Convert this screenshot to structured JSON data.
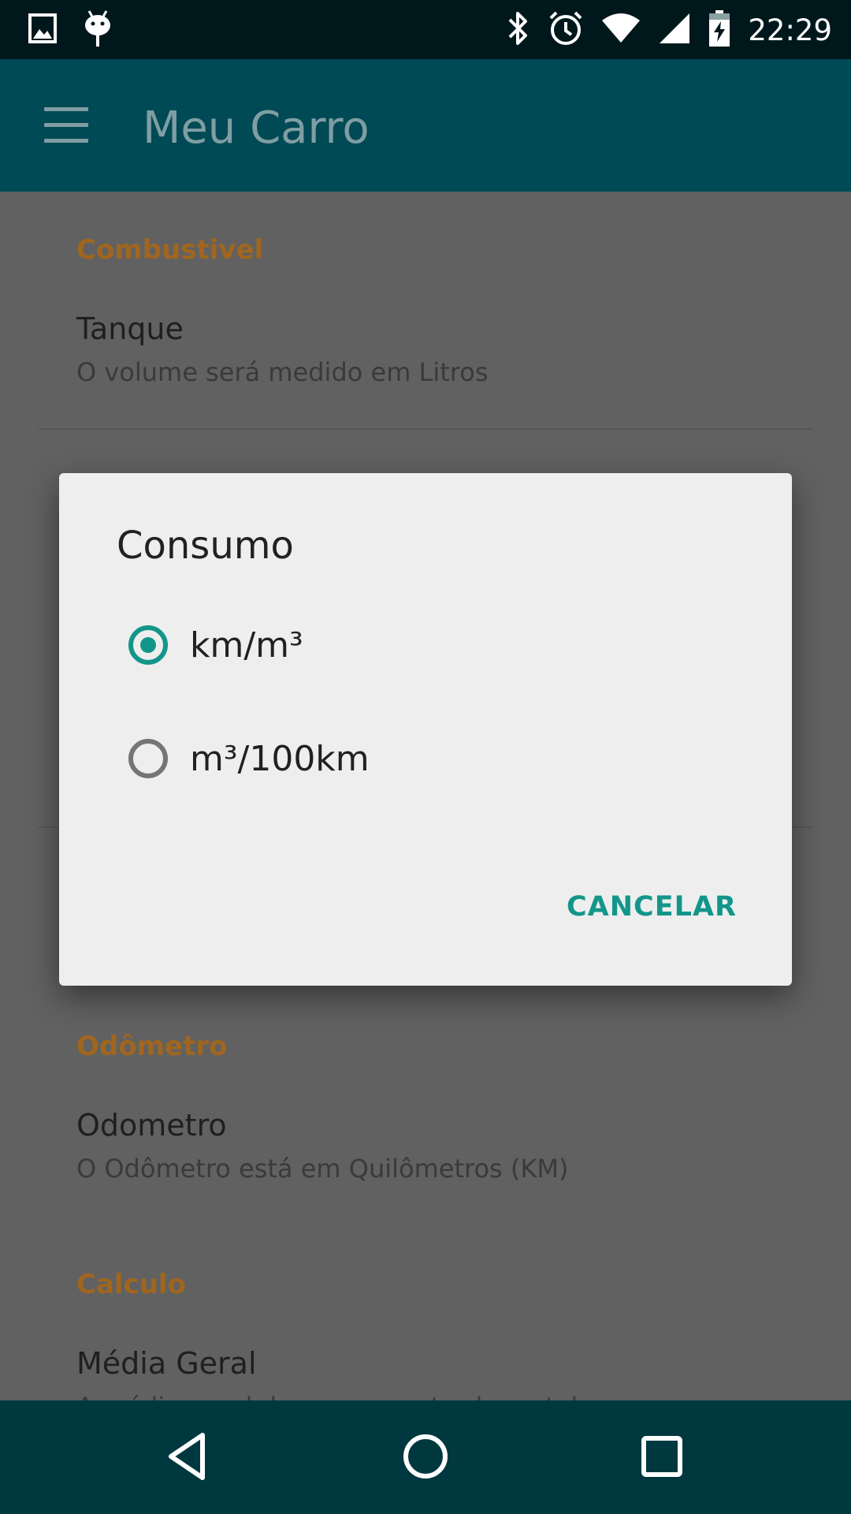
{
  "status_bar": {
    "time": "22:29",
    "left_icons": [
      "image-notification-icon",
      "android-debug-icon"
    ],
    "right_icons": [
      "bluetooth-icon",
      "alarm-icon",
      "wifi-icon",
      "cell-signal-icon",
      "battery-charging-icon"
    ]
  },
  "app_bar": {
    "title": "Meu Carro",
    "menu_icon": "hamburger-menu-icon"
  },
  "settings": {
    "combustivel_header": "Combustivel",
    "tanque_title": "Tanque",
    "tanque_summary": "O volume será medido em Litros",
    "odometro_header": "Odômetro",
    "odometro_title": "Odometro",
    "odometro_summary": "O Odômetro está em Quilômetros (KM)",
    "calculo_header": "Calculo",
    "media_title": "Média Geral",
    "media_summary": "A média geral deve ser mostrada na tela"
  },
  "dialog": {
    "title": "Consumo",
    "options": [
      {
        "label": "km/m³",
        "selected": true
      },
      {
        "label": "m³/100km",
        "selected": false
      }
    ],
    "cancel_label": "CANCELAR"
  },
  "nav_bar": {
    "icons": [
      "back-icon",
      "home-icon",
      "recents-icon"
    ]
  },
  "colors": {
    "accent": "#13968a",
    "section_header": "#a0661f",
    "app_bar": "#004a55",
    "status_bar": "#00181c",
    "nav_bar": "#003840"
  }
}
